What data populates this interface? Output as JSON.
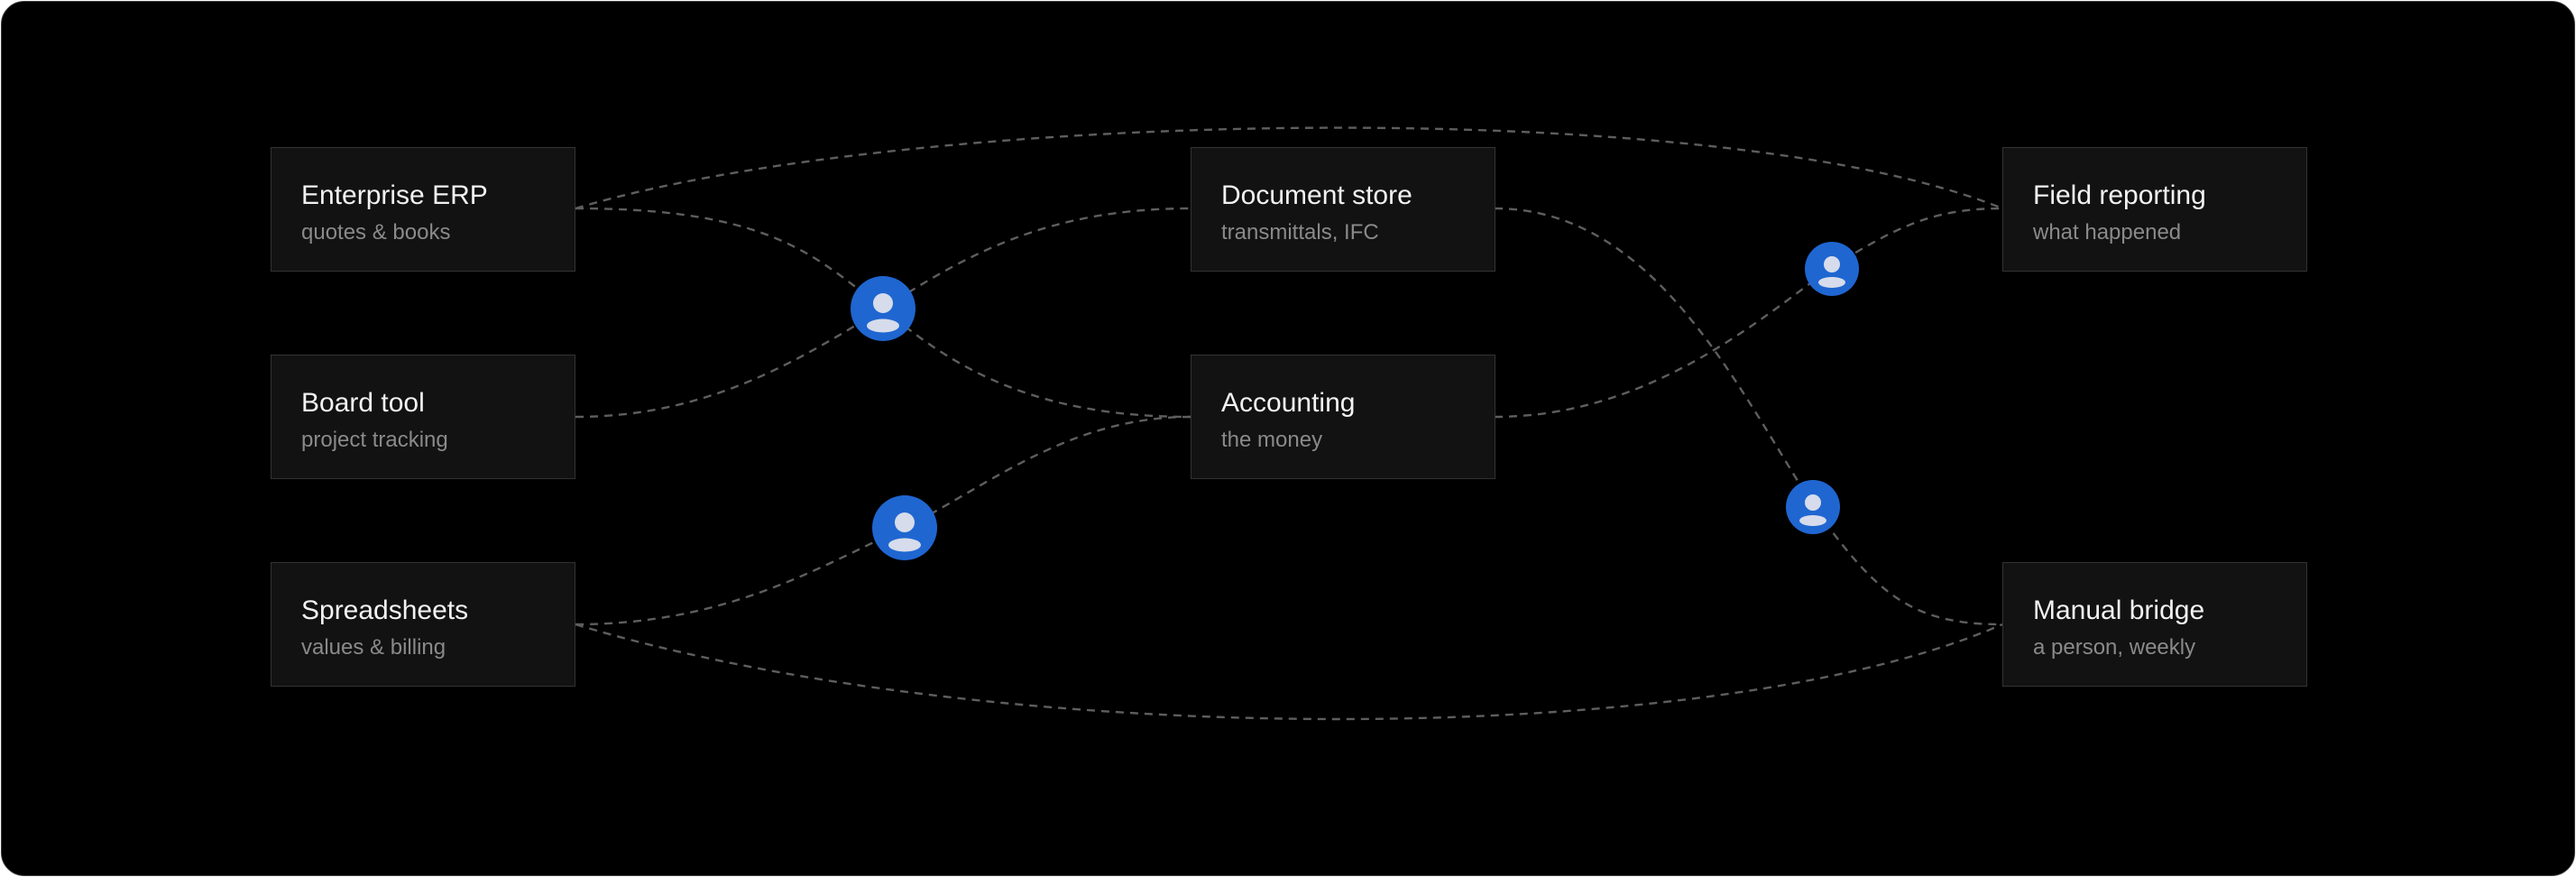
{
  "colors": {
    "background": "#000000",
    "node_fill": "#121212",
    "node_border": "#333333",
    "title_text": "#f2f2f2",
    "subtitle_text": "#8a8a8a",
    "connector": "#5e5e5e",
    "person_badge": "#1f66d1",
    "person_glyph": "#d6dceb"
  },
  "nodes": {
    "erp": {
      "title": "Enterprise ERP",
      "subtitle": "quotes & books"
    },
    "board": {
      "title": "Board tool",
      "subtitle": "project tracking"
    },
    "sheets": {
      "title": "Spreadsheets",
      "subtitle": "values & billing"
    },
    "docs": {
      "title": "Document store",
      "subtitle": "transmittals, IFC"
    },
    "acct": {
      "title": "Accounting",
      "subtitle": "the money"
    },
    "field": {
      "title": "Field reporting",
      "subtitle": "what happened"
    },
    "manual": {
      "title": "Manual bridge",
      "subtitle": "a person, weekly"
    }
  },
  "connections": [
    {
      "from": "erp",
      "to": "field",
      "style": "dashed"
    },
    {
      "from": "erp",
      "to": "acct",
      "style": "dashed",
      "via_person": true
    },
    {
      "from": "board",
      "to": "docs",
      "style": "dashed",
      "via_person": true
    },
    {
      "from": "sheets",
      "to": "acct",
      "style": "dashed",
      "via_person": true
    },
    {
      "from": "sheets",
      "to": "manual",
      "style": "dashed"
    },
    {
      "from": "acct",
      "to": "field",
      "style": "dashed",
      "via_person": true
    },
    {
      "from": "docs",
      "to": "manual",
      "style": "dashed",
      "via_person": true
    }
  ],
  "person_icon": "person-icon"
}
